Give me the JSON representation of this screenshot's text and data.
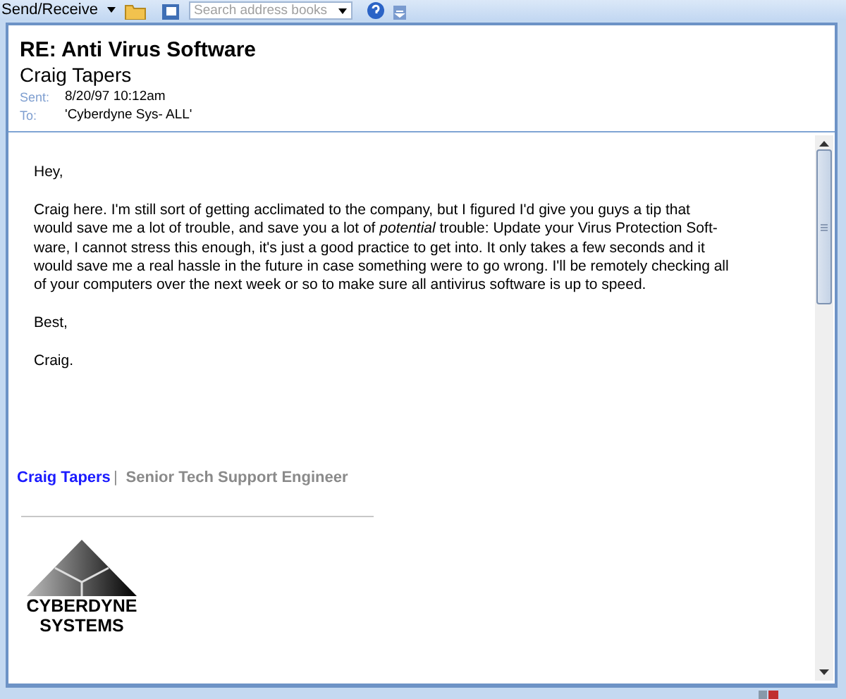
{
  "toolbar": {
    "send_receive": "Send/Receive",
    "search": {
      "placeholder": "Search address books"
    }
  },
  "message": {
    "subject": "RE: Anti Virus Software",
    "sender": "Craig Tapers",
    "fields": [
      {
        "label": "Sent:",
        "value": "8/20/97 10:12am"
      },
      {
        "label": "To:",
        "value": "'Cyberdyne Sys- ALL'"
      }
    ],
    "body": {
      "greeting": "Hey,",
      "paragraph": [
        "Craig here. I'm still sort of getting acclimated to the company, but I figured I'd give you guys a tip that",
        "would save me a lot of trouble, and save you a lot of *potential* trouble: Update your Virus Protection Soft-",
        "ware, I cannot stress this enough, it's just a good practice to get into. It only takes a few seconds and it",
        "would save me a real hassle in the future in case something were to go wrong. I'll be remotely checking all",
        "of your computers over the next week or so to make sure all antivirus software is up to speed."
      ],
      "closing": "Best,",
      "signoff": "Craig."
    },
    "signature": {
      "name": "Craig Tapers",
      "separator": "|",
      "title": "Senior Tech Support Engineer",
      "logo_lines": [
        "CYBERDYNE",
        "SYSTEMS"
      ]
    }
  }
}
